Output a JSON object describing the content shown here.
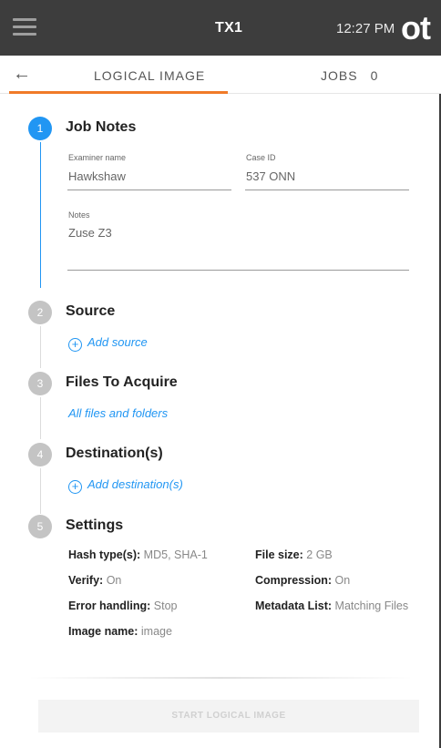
{
  "topbar": {
    "menu_icon": "hamburger-menu-icon",
    "device_name": "TX1",
    "time": "12:27 PM",
    "logo_text": "ot"
  },
  "tabs": {
    "back_icon": "arrow-left-icon",
    "logical_image_label": "LOGICAL IMAGE",
    "jobs_label": "JOBS",
    "jobs_count": "0"
  },
  "colors": {
    "accent": "#2196f3",
    "tab_indicator": "#f07a28",
    "topbar": "#3d3d3d"
  },
  "steps": [
    {
      "number": "1",
      "title": "Job Notes",
      "state": "active"
    },
    {
      "number": "2",
      "title": "Source",
      "state": "inactive"
    },
    {
      "number": "3",
      "title": "Files To Acquire",
      "state": "inactive"
    },
    {
      "number": "4",
      "title": "Destination(s)",
      "state": "inactive"
    },
    {
      "number": "5",
      "title": "Settings",
      "state": "inactive"
    }
  ],
  "job_notes": {
    "examiner_label": "Examiner name",
    "examiner_value": "Hawkshaw",
    "case_id_label": "Case ID",
    "case_id_value": "537 ONN",
    "notes_label": "Notes",
    "notes_value": "Zuse Z3"
  },
  "source": {
    "add_label": "Add source"
  },
  "files": {
    "selection": "All files and folders"
  },
  "destination": {
    "add_label": "Add destination(s)"
  },
  "settings": {
    "hash_label": "Hash type(s):",
    "hash_value": "MD5, SHA-1",
    "file_size_label": "File size:",
    "file_size_value": "2 GB",
    "verify_label": "Verify:",
    "verify_value": "On",
    "compression_label": "Compression:",
    "compression_value": "On",
    "error_label": "Error handling:",
    "error_value": "Stop",
    "metadata_label": "Metadata List:",
    "metadata_value": "Matching Files",
    "image_name_label": "Image name:",
    "image_name_value": "image"
  },
  "start_button": {
    "label": "START LOGICAL IMAGE"
  }
}
